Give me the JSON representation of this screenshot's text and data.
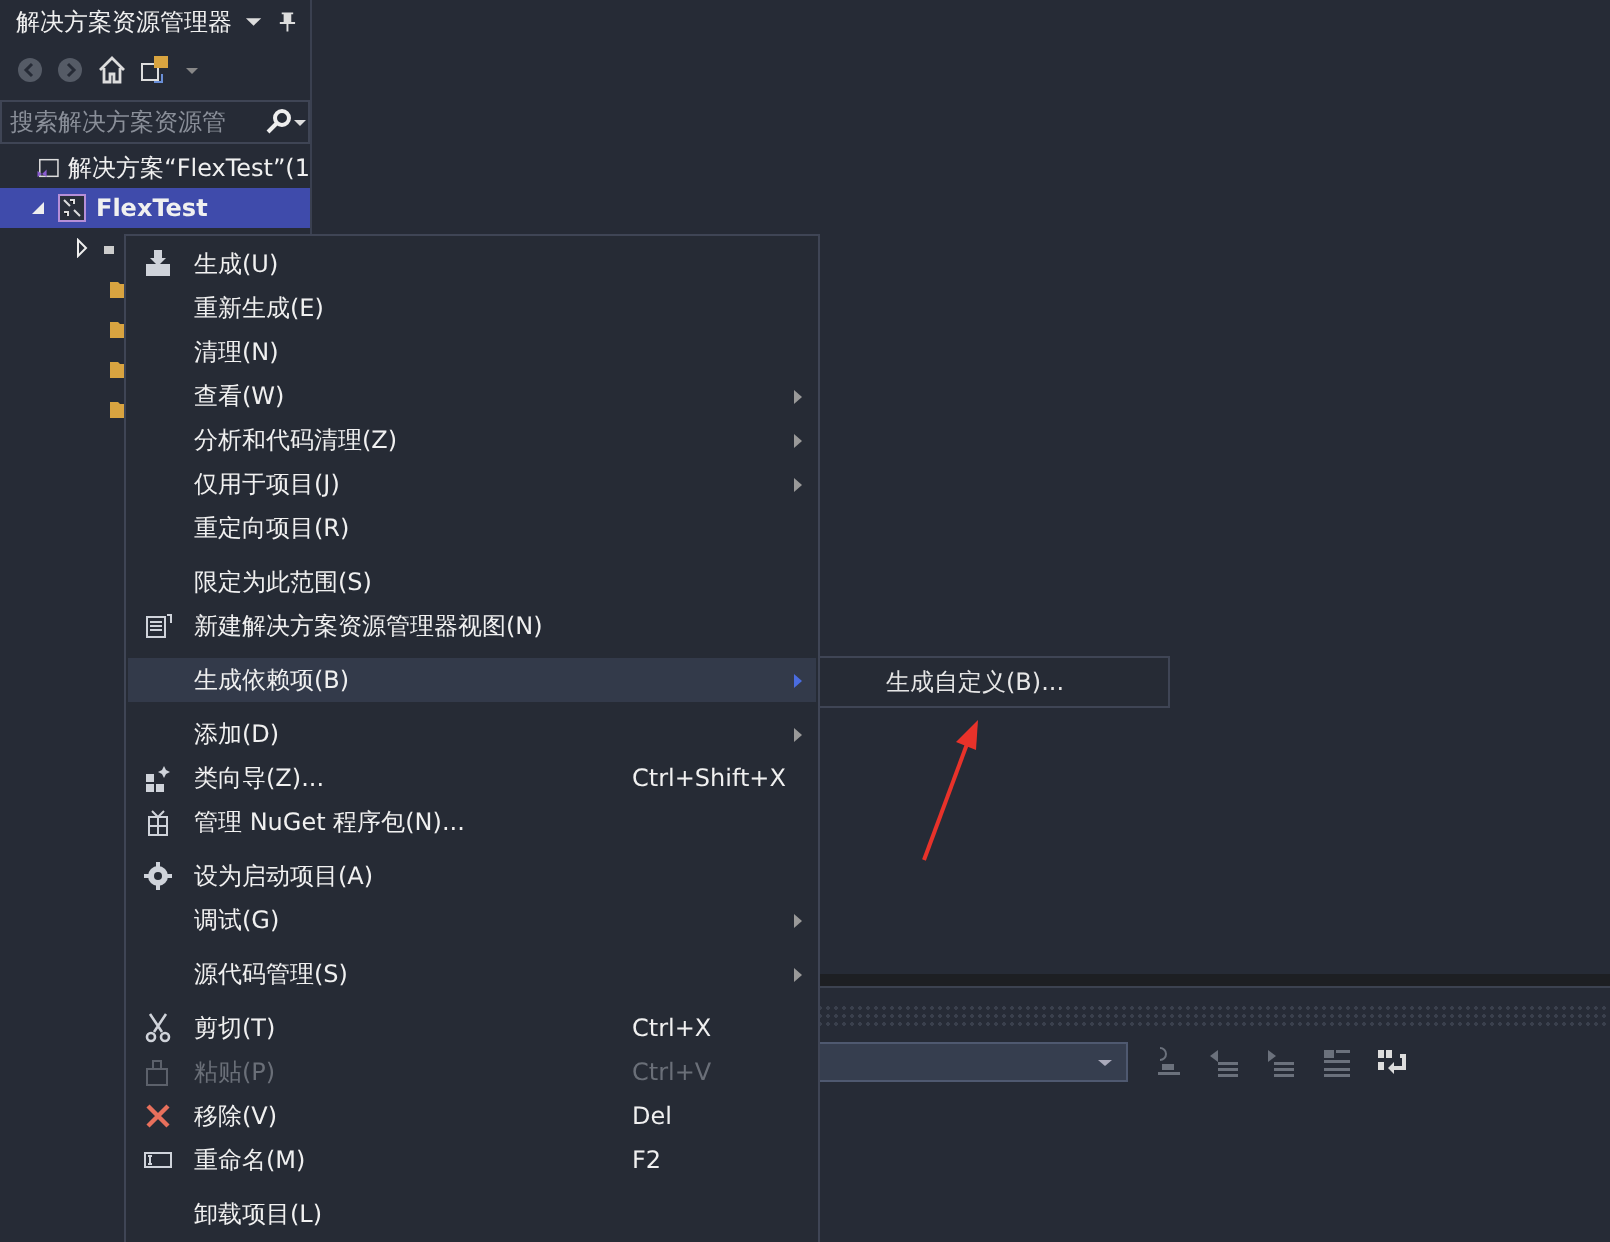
{
  "explorer": {
    "title": "解决方案资源管理器",
    "search": {
      "placeholder": "搜索解决方案资源管"
    },
    "tree": [
      {
        "label": "解决方案“FlexTest”(1",
        "selected": false,
        "children": [
          {
            "label": "FlexTest",
            "selected": true,
            "expanded": true
          }
        ]
      }
    ]
  },
  "context_menu": {
    "items": [
      {
        "kind": "item",
        "label": "生成(U)",
        "selected": false,
        "disabled": false
      },
      {
        "kind": "item",
        "label": "重新生成(E)",
        "selected": false,
        "disabled": false
      },
      {
        "kind": "item",
        "label": "清理(N)",
        "selected": false,
        "disabled": false
      },
      {
        "kind": "item",
        "label": "查看(W)",
        "submenu": true,
        "selected": false,
        "disabled": false
      },
      {
        "kind": "item",
        "label": "分析和代码清理(Z)",
        "submenu": true,
        "selected": false,
        "disabled": false
      },
      {
        "kind": "item",
        "label": "仅用于项目(J)",
        "submenu": true,
        "selected": false,
        "disabled": false
      },
      {
        "kind": "item",
        "label": "重定向项目(R)",
        "selected": false,
        "disabled": false
      },
      {
        "kind": "separator"
      },
      {
        "kind": "item",
        "label": "限定为此范围(S)",
        "selected": false,
        "disabled": false
      },
      {
        "kind": "item",
        "label": "新建解决方案资源管理器视图(N)",
        "selected": false,
        "disabled": false
      },
      {
        "kind": "separator"
      },
      {
        "kind": "item",
        "label": "生成依赖项(B)",
        "submenu": true,
        "selected": true,
        "disabled": false
      },
      {
        "kind": "separator"
      },
      {
        "kind": "item",
        "label": "添加(D)",
        "submenu": true,
        "selected": false,
        "disabled": false
      },
      {
        "kind": "item",
        "label": "类向导(Z)...",
        "shortcut": "Ctrl+Shift+X",
        "selected": false,
        "disabled": false
      },
      {
        "kind": "item",
        "label": "管理 NuGet 程序包(N)...",
        "selected": false,
        "disabled": false
      },
      {
        "kind": "separator"
      },
      {
        "kind": "item",
        "label": "设为启动项目(A)",
        "selected": false,
        "disabled": false
      },
      {
        "kind": "item",
        "label": "调试(G)",
        "submenu": true,
        "selected": false,
        "disabled": false
      },
      {
        "kind": "separator"
      },
      {
        "kind": "item",
        "label": "源代码管理(S)",
        "submenu": true,
        "selected": false,
        "disabled": false
      },
      {
        "kind": "separator"
      },
      {
        "kind": "item",
        "label": "剪切(T)",
        "shortcut": "Ctrl+X",
        "selected": false,
        "disabled": false
      },
      {
        "kind": "item",
        "label": "粘贴(P)",
        "shortcut": "Ctrl+V",
        "selected": false,
        "disabled": true
      },
      {
        "kind": "item",
        "label": "移除(V)",
        "shortcut": "Del",
        "selected": false,
        "disabled": false
      },
      {
        "kind": "item",
        "label": "重命名(M)",
        "shortcut": "F2",
        "selected": false,
        "disabled": false
      },
      {
        "kind": "separator"
      },
      {
        "kind": "item",
        "label": "卸载项目(L)",
        "selected": false,
        "disabled": false
      }
    ]
  },
  "submenu": {
    "items": [
      {
        "label": "生成自定义(B)...",
        "selected": false
      }
    ]
  }
}
